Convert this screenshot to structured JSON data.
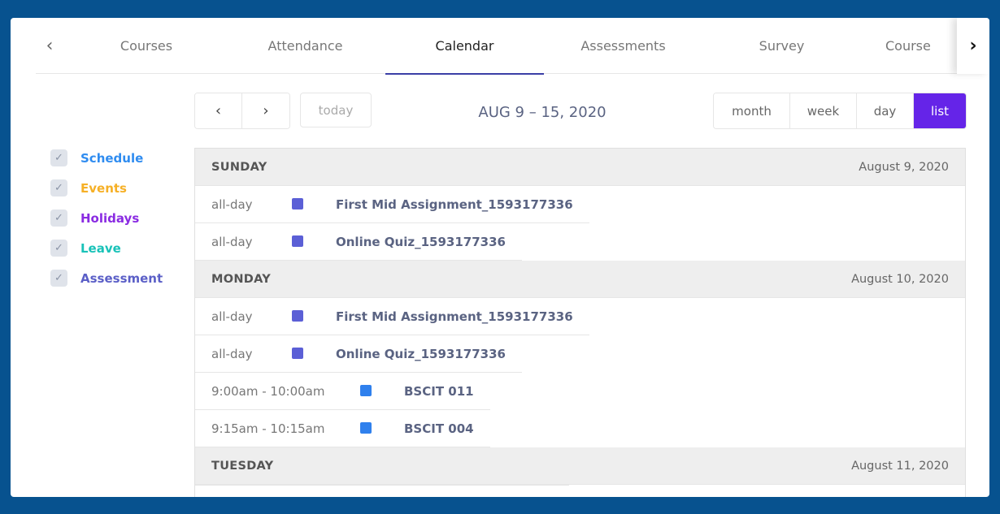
{
  "tabs": {
    "items": [
      {
        "label": "Courses"
      },
      {
        "label": "Attendance"
      },
      {
        "label": "Calendar"
      },
      {
        "label": "Assessments"
      },
      {
        "label": "Survey"
      },
      {
        "label": "Course"
      }
    ],
    "active": "Calendar"
  },
  "filters": [
    {
      "label": "Schedule",
      "color": "#2f8cf0",
      "checked": true
    },
    {
      "label": "Events",
      "color": "#f6b026",
      "checked": true
    },
    {
      "label": "Holidays",
      "color": "#8a2be2",
      "checked": true
    },
    {
      "label": "Leave",
      "color": "#19c2b8",
      "checked": true
    },
    {
      "label": "Assessment",
      "color": "#5b5fc7",
      "checked": true
    }
  ],
  "toolbar": {
    "prev_icon": "‹",
    "next_icon": "›",
    "today_label": "today",
    "range_title": "AUG 9 – 15, 2020",
    "views": [
      {
        "label": "month"
      },
      {
        "label": "week"
      },
      {
        "label": "day"
      },
      {
        "label": "list"
      }
    ],
    "active_view": "list"
  },
  "days": [
    {
      "name": "SUNDAY",
      "date": "August 9, 2020",
      "events": [
        {
          "time": "all-day",
          "title": "First Mid Assignment_1593177336",
          "color": "#5b5fd6"
        },
        {
          "time": "all-day",
          "title": "Online Quiz_1593177336",
          "color": "#5b5fd6"
        }
      ]
    },
    {
      "name": "MONDAY",
      "date": "August 10, 2020",
      "events": [
        {
          "time": "all-day",
          "title": "First Mid Assignment_1593177336",
          "color": "#5b5fd6"
        },
        {
          "time": "all-day",
          "title": "Online Quiz_1593177336",
          "color": "#5b5fd6"
        },
        {
          "time": "9:00am - 10:00am",
          "title": "BSCIT 011",
          "color": "#2f80ed"
        },
        {
          "time": "9:15am - 10:15am",
          "title": "BSCIT 004",
          "color": "#2f80ed"
        }
      ]
    },
    {
      "name": "TUESDAY",
      "date": "August 11, 2020",
      "events": []
    }
  ]
}
